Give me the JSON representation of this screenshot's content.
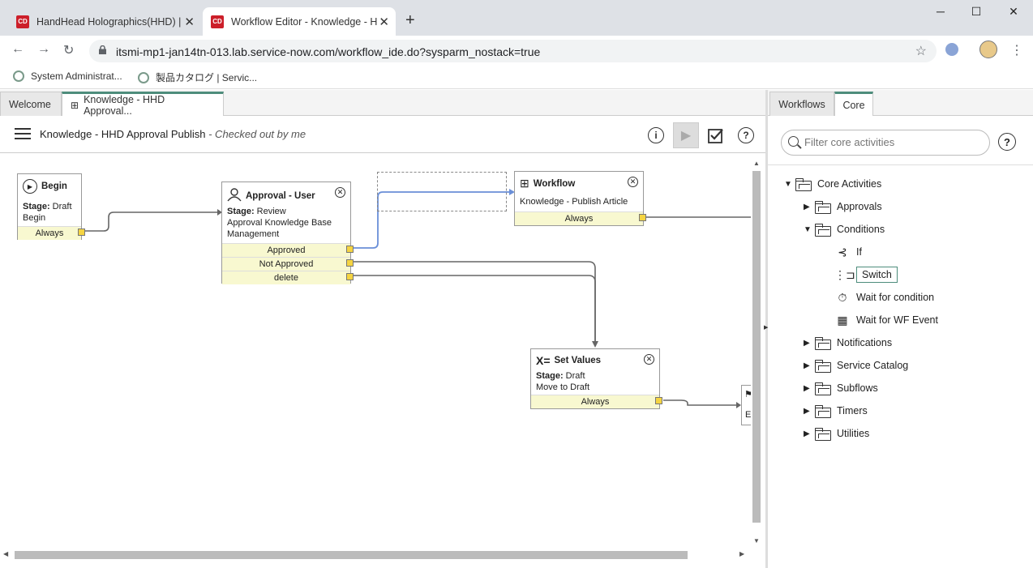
{
  "browser": {
    "tabs": [
      {
        "label": "HandHead Holographics(HHD) | S",
        "favicon": "CD"
      },
      {
        "label": "Workflow Editor - Knowledge - H",
        "favicon": "CD"
      }
    ],
    "url": "itsmi-mp1-jan14tn-013.lab.service-now.com/workflow_ide.do?sysparm_nostack=true",
    "bookmarks": [
      "System Administrat...",
      "製品カタログ | Servic..."
    ]
  },
  "editor": {
    "tabs": [
      "Welcome",
      "Knowledge - HHD Approval..."
    ],
    "title": "Knowledge - HHD Approval Publish",
    "subtitle": " - Checked out by me"
  },
  "nodes": {
    "begin": {
      "title": "Begin",
      "stage_label": "Stage:",
      "stage": " Draft",
      "line2": "Begin",
      "condition": "Always"
    },
    "approval": {
      "title": "Approval - User",
      "stage_label": "Stage:",
      "stage": " Review",
      "line2": "Approval Knowledge Base",
      "line3": "Management",
      "conditions": [
        "Approved",
        "Not Approved",
        "delete"
      ]
    },
    "workflow": {
      "title": "Workflow",
      "line2": "Knowledge - Publish Article",
      "condition": "Always"
    },
    "setvalues": {
      "title": "Set Values",
      "icon": "X=",
      "stage_label": "Stage:",
      "stage": " Draft",
      "line2": "Move to Draft",
      "condition": "Always"
    },
    "end": {
      "line1": "E"
    }
  },
  "right": {
    "tabs": [
      "Workflows",
      "Core"
    ],
    "filter_placeholder": "Filter core activities",
    "tree": {
      "root": "Core Activities",
      "approvals": "Approvals",
      "conditions": "Conditions",
      "cond_items": [
        "If",
        "Switch",
        "Wait for condition",
        "Wait for WF Event"
      ],
      "others": [
        "Notifications",
        "Service Catalog",
        "Subflows",
        "Timers",
        "Utilities"
      ]
    }
  }
}
